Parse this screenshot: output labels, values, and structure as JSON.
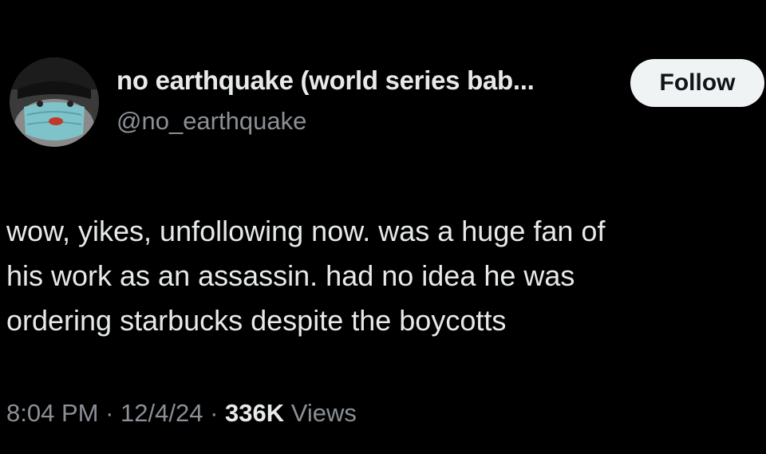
{
  "profile": {
    "display_name": "no earthquake (world series bab...",
    "handle": "@no_earthquake",
    "avatar_icon": "masked-face-avatar"
  },
  "follow_button": {
    "label": "Follow"
  },
  "tweet": {
    "lines": [
      "wow, yikes, unfollowing now. was a huge fan of",
      "his work as an assassin. had no idea he was",
      "ordering starbucks despite the boycotts"
    ]
  },
  "meta": {
    "time": "8:04 PM",
    "separator": " · ",
    "date": "12/4/24",
    "views_count": "336K",
    "views_label": "Views"
  },
  "colors": {
    "background": "#000000",
    "text_primary": "#e7e9ea",
    "text_secondary": "#8b9096",
    "button_bg": "#eff3f4",
    "button_text": "#0f1419"
  }
}
